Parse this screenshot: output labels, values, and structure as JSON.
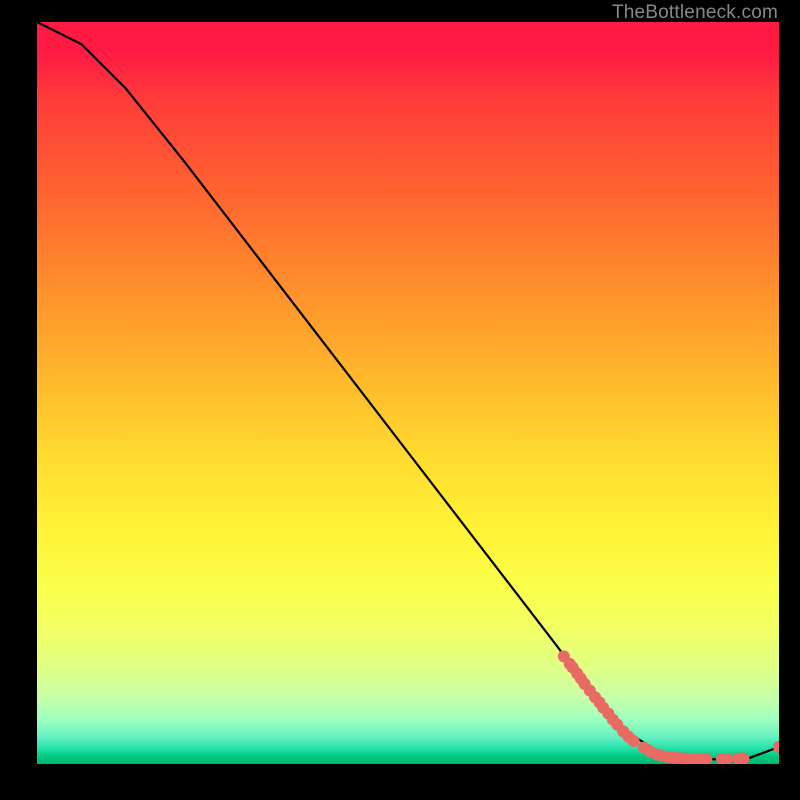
{
  "watermark": "TheBottleneck.com",
  "chart_data": {
    "type": "line",
    "xlim": [
      0,
      100
    ],
    "ylim": [
      0,
      100
    ],
    "curve": [
      {
        "x": 0,
        "y": 100
      },
      {
        "x": 6,
        "y": 97
      },
      {
        "x": 12,
        "y": 91
      },
      {
        "x": 20,
        "y": 81
      },
      {
        "x": 30,
        "y": 68
      },
      {
        "x": 40,
        "y": 55
      },
      {
        "x": 50,
        "y": 42
      },
      {
        "x": 60,
        "y": 29
      },
      {
        "x": 70,
        "y": 16
      },
      {
        "x": 76,
        "y": 8
      },
      {
        "x": 80,
        "y": 4
      },
      {
        "x": 84,
        "y": 1.5
      },
      {
        "x": 88,
        "y": 0.8
      },
      {
        "x": 92,
        "y": 0.6
      },
      {
        "x": 96,
        "y": 0.8
      },
      {
        "x": 100,
        "y": 2.3
      }
    ],
    "scatter": [
      {
        "x": 71,
        "y": 14.5
      },
      {
        "x": 71.8,
        "y": 13.5
      },
      {
        "x": 72.2,
        "y": 13
      },
      {
        "x": 72.8,
        "y": 12.2
      },
      {
        "x": 73.3,
        "y": 11.5
      },
      {
        "x": 73.8,
        "y": 10.8
      },
      {
        "x": 74.5,
        "y": 9.9
      },
      {
        "x": 75.2,
        "y": 9
      },
      {
        "x": 75.8,
        "y": 8.3
      },
      {
        "x": 76.3,
        "y": 7.6
      },
      {
        "x": 77,
        "y": 6.8
      },
      {
        "x": 77.6,
        "y": 6
      },
      {
        "x": 78.2,
        "y": 5.3
      },
      {
        "x": 79,
        "y": 4.4
      },
      {
        "x": 79.7,
        "y": 3.7
      },
      {
        "x": 80.4,
        "y": 3.1
      },
      {
        "x": 81.8,
        "y": 2.2
      },
      {
        "x": 82.6,
        "y": 1.7
      },
      {
        "x": 83.5,
        "y": 1.3
      },
      {
        "x": 84.2,
        "y": 1.1
      },
      {
        "x": 85,
        "y": 0.95
      },
      {
        "x": 85.8,
        "y": 0.85
      },
      {
        "x": 86.4,
        "y": 0.8
      },
      {
        "x": 87.2,
        "y": 0.75
      },
      {
        "x": 88,
        "y": 0.7
      },
      {
        "x": 88.8,
        "y": 0.68
      },
      {
        "x": 89.5,
        "y": 0.66
      },
      {
        "x": 90.2,
        "y": 0.65
      },
      {
        "x": 92.3,
        "y": 0.65
      },
      {
        "x": 93,
        "y": 0.67
      },
      {
        "x": 94.5,
        "y": 0.72
      },
      {
        "x": 95.2,
        "y": 0.76
      },
      {
        "x": 100,
        "y": 2.3
      }
    ],
    "curve_color": "#000000",
    "point_color": "#e86a62"
  }
}
